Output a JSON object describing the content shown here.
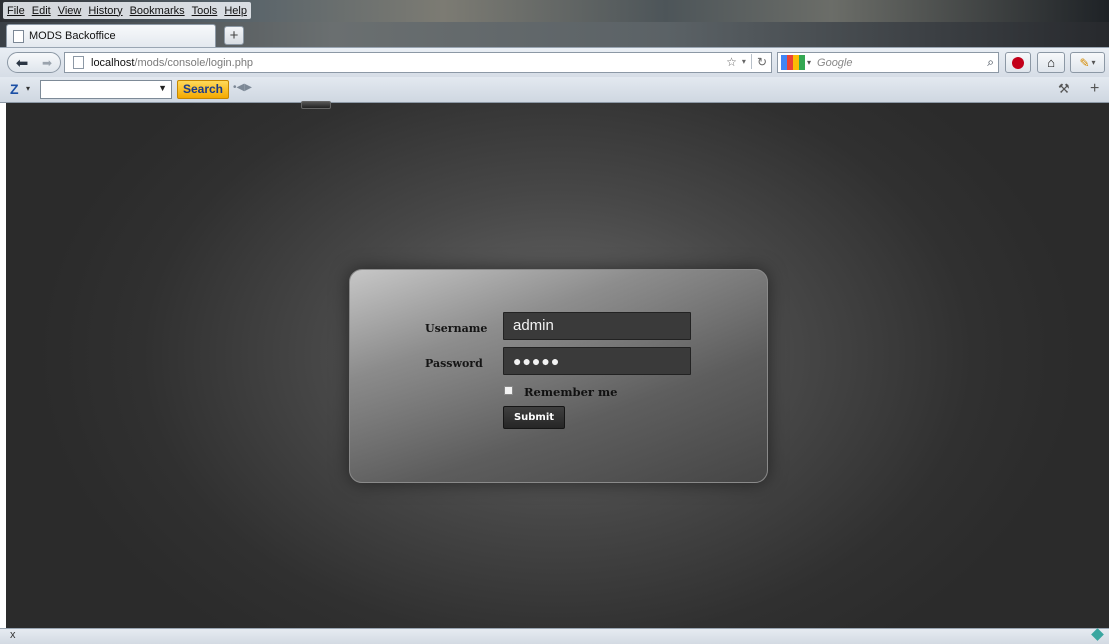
{
  "menubar": {
    "items": [
      "File",
      "Edit",
      "View",
      "History",
      "Bookmarks",
      "Tools",
      "Help"
    ]
  },
  "tab": {
    "title": "MODS Backoffice",
    "new_tab_label": "+"
  },
  "navbar": {
    "back_icon": "arrow-left-icon",
    "forward_icon": "arrow-right-icon",
    "url_host": "localhost",
    "url_path": "/mods/console/login.php",
    "search_placeholder": "Google",
    "engine_colors": [
      "#4285f4",
      "#ea4335",
      "#fbbc05",
      "#34a853"
    ]
  },
  "toolbar": {
    "logo": "Z",
    "search_button": "Search"
  },
  "login": {
    "username_label": "Username",
    "password_label": "Password",
    "username_value": "admin",
    "password_value": "●●●●●",
    "remember_label": "Remember me",
    "remember_checked": false,
    "submit_label": "Submit"
  },
  "statusbar": {
    "close_label": "x"
  }
}
